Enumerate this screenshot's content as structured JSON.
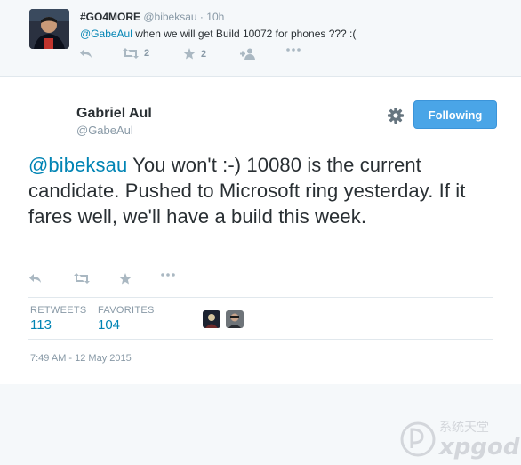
{
  "reply": {
    "name": "#GO4MORE",
    "handle": "@bibeksau",
    "separator": "·",
    "time": "10h",
    "mention": "@GabeAul",
    "text": " when we will get Build 10072  for phones ??? :(",
    "retweet_count": "2",
    "favorite_count": "2"
  },
  "tweet": {
    "author_name": "Gabriel Aul",
    "author_handle": "@GabeAul",
    "follow_label": "Following",
    "mention": "@bibeksau",
    "text": " You won't :-) 10080 is the current candidate. Pushed to Microsoft ring yesterday. If it fares well, we'll have a build this week.",
    "stats": {
      "retweets_label": "RETWEETS",
      "retweets_value": "113",
      "favorites_label": "FAVORITES",
      "favorites_value": "104"
    },
    "timestamp": "7:49 AM - 12 May 2015"
  },
  "colors": {
    "accent": "#4aa5e7",
    "link": "#0084b4",
    "muted": "#8899a6"
  },
  "watermark": {
    "text_cn": "系统天堂",
    "text_en": "xpgod"
  }
}
